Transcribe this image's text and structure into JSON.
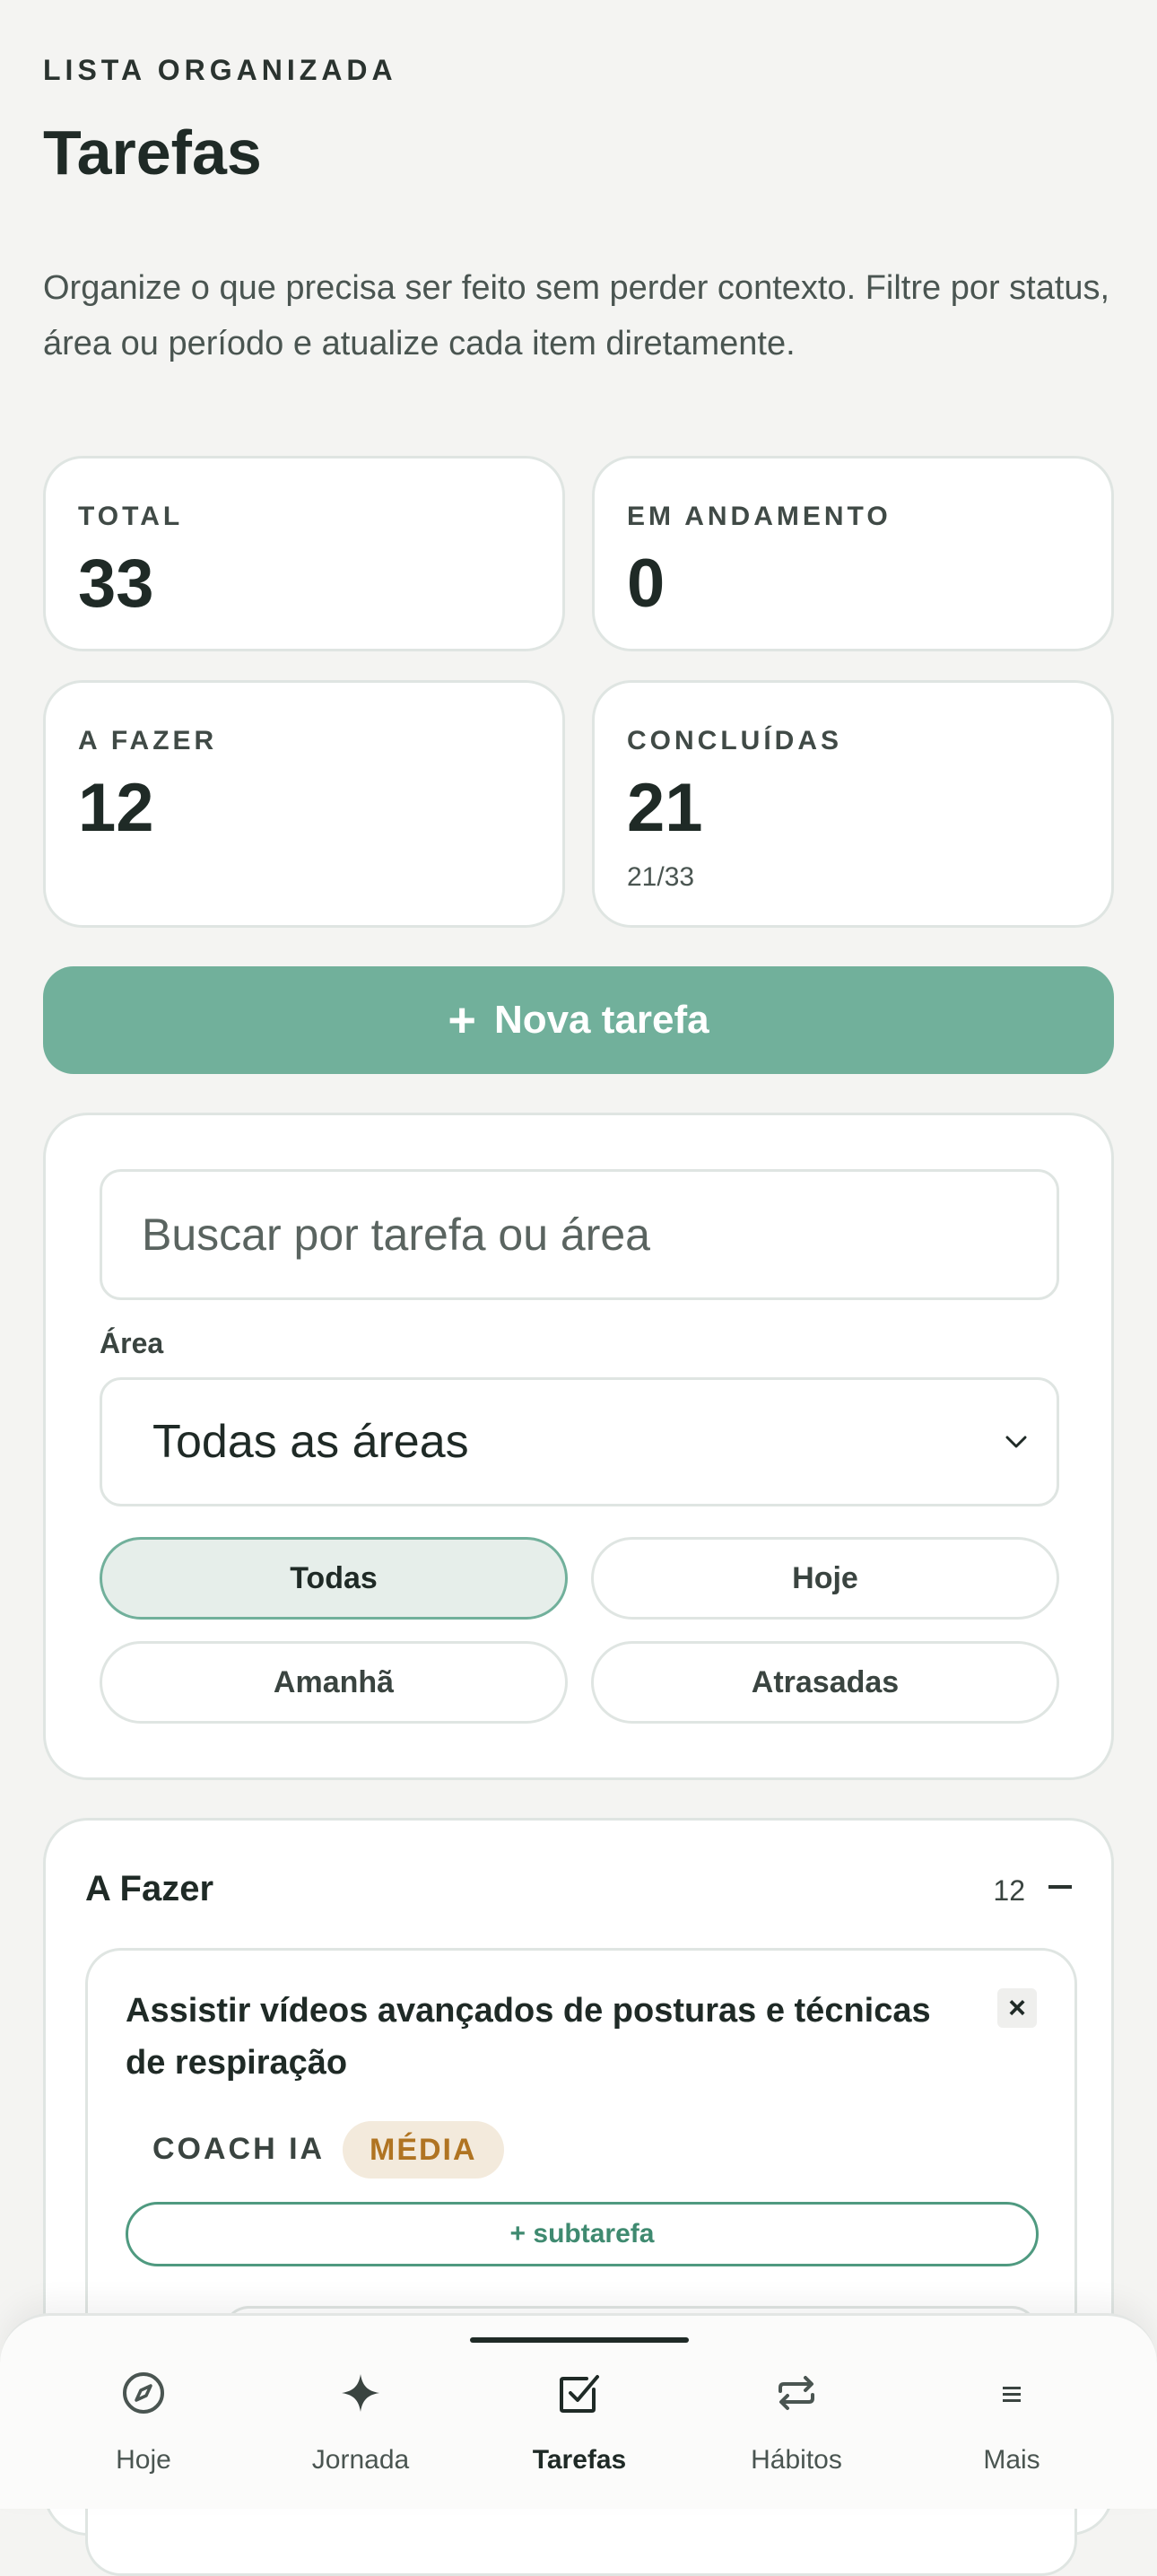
{
  "header": {
    "eyebrow": "LISTA ORGANIZADA",
    "title": "Tarefas",
    "subtitle": "Organize o que precisa ser feito sem perder contexto. Filtre por status, área ou período e atualize cada item diretamente."
  },
  "stats": [
    {
      "label": "TOTAL",
      "value": "33",
      "sub": ""
    },
    {
      "label": "EM ANDAMENTO",
      "value": "0",
      "sub": ""
    },
    {
      "label": "A FAZER",
      "value": "12",
      "sub": ""
    },
    {
      "label": "CONCLUÍDAS",
      "value": "21",
      "sub": "21/33"
    }
  ],
  "actions": {
    "new_task_icon": "+",
    "new_task_label": "Nova tarefa"
  },
  "filters": {
    "search_placeholder": "Buscar por tarefa ou área",
    "area_label": "Área",
    "area_selected": "Todas as áreas",
    "periods": [
      "Todas",
      "Hoje",
      "Amanhã",
      "Atrasadas"
    ],
    "active_period": "Todas"
  },
  "groups": [
    {
      "title": "A Fazer",
      "count": "12",
      "tasks": [
        {
          "title": "Assistir vídeos avançados de posturas e técnicas de respiração",
          "area": "COACH IA",
          "priority": "MÉDIA",
          "add_subtask_label": "+ subtarefa",
          "close_icon": "×"
        }
      ]
    }
  ],
  "nav": {
    "items": [
      {
        "label": "Hoje",
        "icon": "compass-icon"
      },
      {
        "label": "Jornada",
        "icon": "sparkle-icon"
      },
      {
        "label": "Tarefas",
        "icon": "checkbox-icon"
      },
      {
        "label": "Hábitos",
        "icon": "repeat-icon"
      },
      {
        "label": "Mais",
        "icon": "menu-icon"
      }
    ],
    "active": "Tarefas"
  },
  "colors": {
    "accent": "#71b09b",
    "accent_dark": "#3f8a70",
    "priority_bg": "#f3eadc",
    "priority_text": "#b07422",
    "background": "#f4f4f2"
  }
}
